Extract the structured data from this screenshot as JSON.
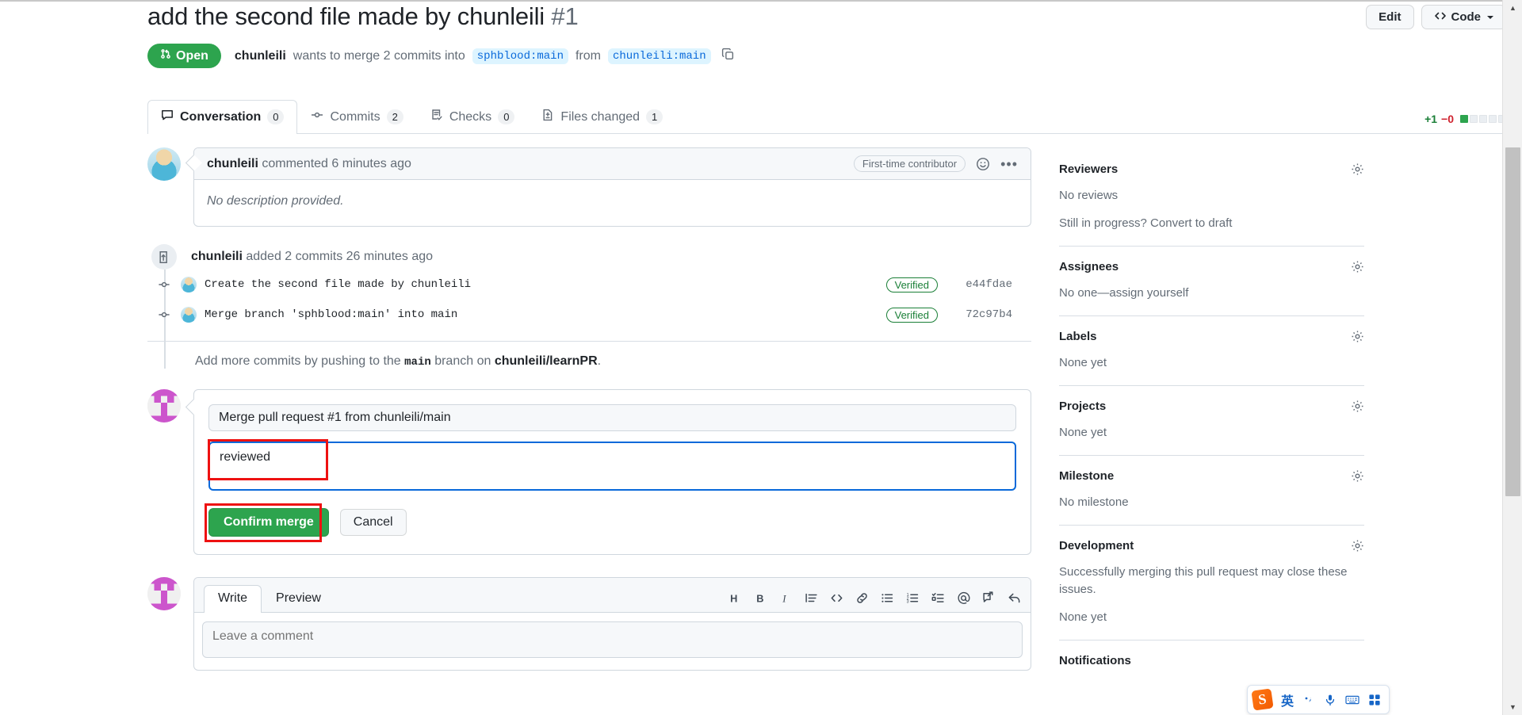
{
  "header": {
    "pr_title": "add the second file made by chunleili",
    "pr_number": "#1",
    "edit_label": "Edit",
    "code_label": "Code",
    "state": "Open",
    "meta_author": "chunleili",
    "meta_text_1": "wants to merge 2 commits into",
    "base_branch": "sphblood:main",
    "meta_text_2": "from",
    "head_branch": "chunleili:main"
  },
  "tabs": [
    {
      "label": "Conversation",
      "count": "0",
      "icon": "comment-icon"
    },
    {
      "label": "Commits",
      "count": "2",
      "icon": "commit-icon"
    },
    {
      "label": "Checks",
      "count": "0",
      "icon": "checklist-icon"
    },
    {
      "label": "Files changed",
      "count": "1",
      "icon": "file-diff-icon"
    }
  ],
  "diffstat": {
    "additions": "+1",
    "deletions": "−0",
    "blocks_total": 5,
    "blocks_on": 1
  },
  "comment": {
    "author": "chunleili",
    "action": "commented 6 minutes ago",
    "badge": "First-time contributor",
    "body": "No description provided."
  },
  "commits_group": {
    "author": "chunleili",
    "summary": "added 2 commits 26 minutes ago",
    "rows": [
      {
        "message": "Create the second file made by chunleili",
        "verified": "Verified",
        "sha": "e44fdae"
      },
      {
        "message": "Merge branch 'sphblood:main' into main",
        "verified": "Verified",
        "sha": "72c97b4"
      }
    ]
  },
  "push_note": {
    "prefix": "Add more commits by pushing to the",
    "branch": "main",
    "middle": "branch on",
    "repo": "chunleili/learnPR",
    "suffix": "."
  },
  "merge_form": {
    "title_value": "Merge pull request #1 from chunleili/main",
    "description_value": "reviewed",
    "confirm_label": "Confirm merge",
    "cancel_label": "Cancel"
  },
  "editor": {
    "write_tab": "Write",
    "preview_tab": "Preview",
    "placeholder": "Leave a comment",
    "tools": [
      {
        "name": "heading-icon",
        "glyph": "H"
      },
      {
        "name": "bold-icon",
        "glyph": "B"
      },
      {
        "name": "italic-icon",
        "glyph": "I"
      },
      {
        "name": "quote-icon",
        "glyph": "≡"
      },
      {
        "name": "code-icon",
        "glyph": "<>"
      },
      {
        "name": "link-icon",
        "glyph": "🔗"
      },
      {
        "name": "unordered-list-icon",
        "glyph": "☰"
      },
      {
        "name": "ordered-list-icon",
        "glyph": "≡"
      },
      {
        "name": "task-list-icon",
        "glyph": "☑"
      },
      {
        "name": "mention-icon",
        "glyph": "@"
      },
      {
        "name": "cross-reference-icon",
        "glyph": "↗"
      },
      {
        "name": "reply-icon",
        "glyph": "↩"
      }
    ]
  },
  "sidebar": [
    {
      "title": "Reviewers",
      "lines": [
        "No reviews",
        "Still in progress? Convert to draft"
      ]
    },
    {
      "title": "Assignees",
      "lines": [
        "No one—assign yourself"
      ]
    },
    {
      "title": "Labels",
      "lines": [
        "None yet"
      ]
    },
    {
      "title": "Projects",
      "lines": [
        "None yet"
      ]
    },
    {
      "title": "Milestone",
      "lines": [
        "No milestone"
      ]
    },
    {
      "title": "Development",
      "lines": [
        "Successfully merging this pull request may close these issues.",
        "None yet"
      ]
    },
    {
      "title": "Notifications",
      "lines": []
    }
  ],
  "ime": {
    "logo": "S",
    "items": [
      {
        "name": "language-mode-english",
        "glyph": "英"
      },
      {
        "name": "punctuation-toggle",
        "glyph": "，"
      },
      {
        "name": "voice-input-icon",
        "glyph": "🎤"
      },
      {
        "name": "soft-keyboard-icon",
        "glyph": "⌨"
      },
      {
        "name": "ime-apps-icon",
        "glyph": "⬛"
      }
    ]
  },
  "colors": {
    "open_green": "#2da44e",
    "link_blue": "#0969da",
    "annotation_red": "#ee1111",
    "verified_green": "#1a7f37"
  }
}
